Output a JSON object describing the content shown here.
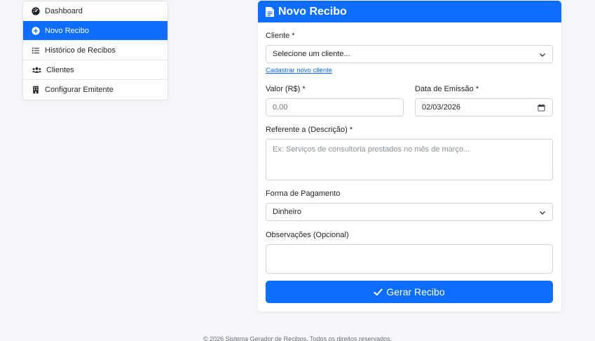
{
  "sidebar": {
    "items": [
      {
        "label": "Dashboard",
        "icon": "gauge-icon",
        "active": false
      },
      {
        "label": "Novo Recibo",
        "icon": "plus-circle-icon",
        "active": true
      },
      {
        "label": "Histórico de Recibos",
        "icon": "list-icon",
        "active": false
      },
      {
        "label": "Clientes",
        "icon": "users-icon",
        "active": false
      },
      {
        "label": "Configurar Emitente",
        "icon": "building-icon",
        "active": false
      }
    ]
  },
  "form": {
    "title": "Novo Recibo",
    "cliente_label": "Cliente *",
    "cliente_value": "Selecione um cliente...",
    "cadastrar_link": "Cadastrar novo cliente",
    "valor_label": "Valor (R$) *",
    "valor_placeholder": "0,00",
    "data_label": "Data de Emissão *",
    "data_value": "02/03/2026",
    "referente_label": "Referente a (Descrição) *",
    "referente_placeholder": "Ex: Serviços de consultoria prestados no mês de março...",
    "pagamento_label": "Forma de Pagamento",
    "pagamento_value": "Dinheiro",
    "observacoes_label": "Observações (Opcional)",
    "submit_label": "Gerar Recibo"
  },
  "footer": {
    "text": "© 2026 Sistema Gerador de Recibos. Todos os direitos reservados."
  },
  "colors": {
    "primary": "#0d6efd",
    "background": "#f4f6fa",
    "border": "#ced4da"
  }
}
